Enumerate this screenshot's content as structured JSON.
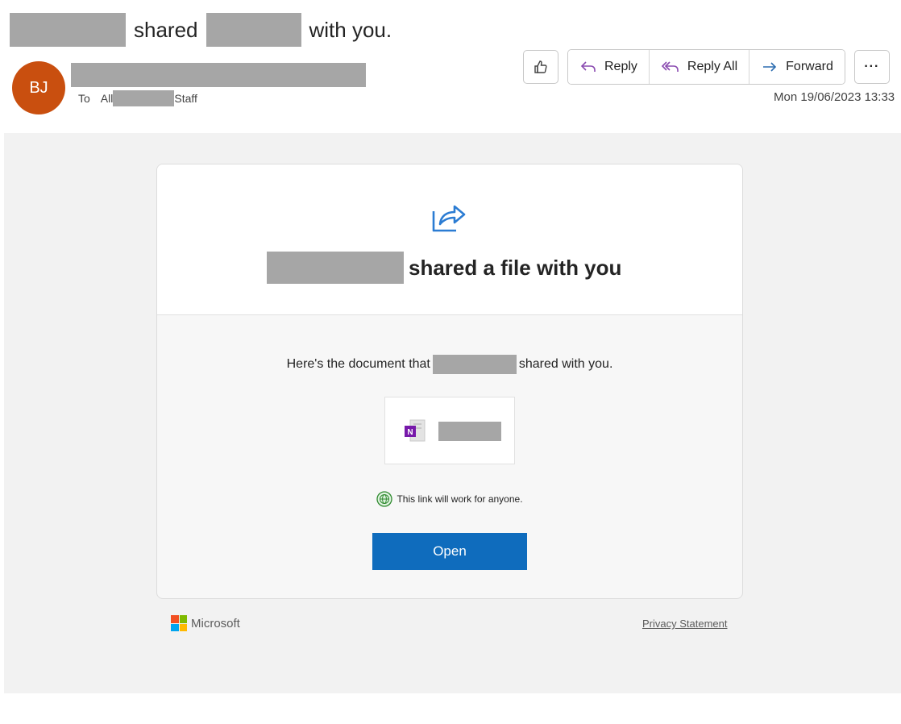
{
  "email": {
    "subject": {
      "shared_word": "shared",
      "with_you": "with you."
    },
    "sender": {
      "initials": "BJ",
      "avatar_color": "#c94f0f"
    },
    "recipient": {
      "to_label": "To",
      "prefix": "All",
      "suffix": "Staff"
    },
    "datetime": "Mon 19/06/2023 13:33"
  },
  "toolbar": {
    "like_icon": "thumbs-up-icon",
    "reply_label": "Reply",
    "reply_all_label": "Reply All",
    "forward_label": "Forward",
    "more_label": "···"
  },
  "card": {
    "share_icon": "share-arrow-icon",
    "title_suffix": "shared a file with you",
    "desc_prefix": "Here's the document that",
    "desc_suffix": "shared with you.",
    "file_icon": "onenote-icon",
    "link_note": "This link will work for anyone.",
    "open_label": "Open",
    "accent_color": "#0f6cbd"
  },
  "footer": {
    "logo_text": "Microsoft",
    "privacy_label": "Privacy Statement"
  }
}
